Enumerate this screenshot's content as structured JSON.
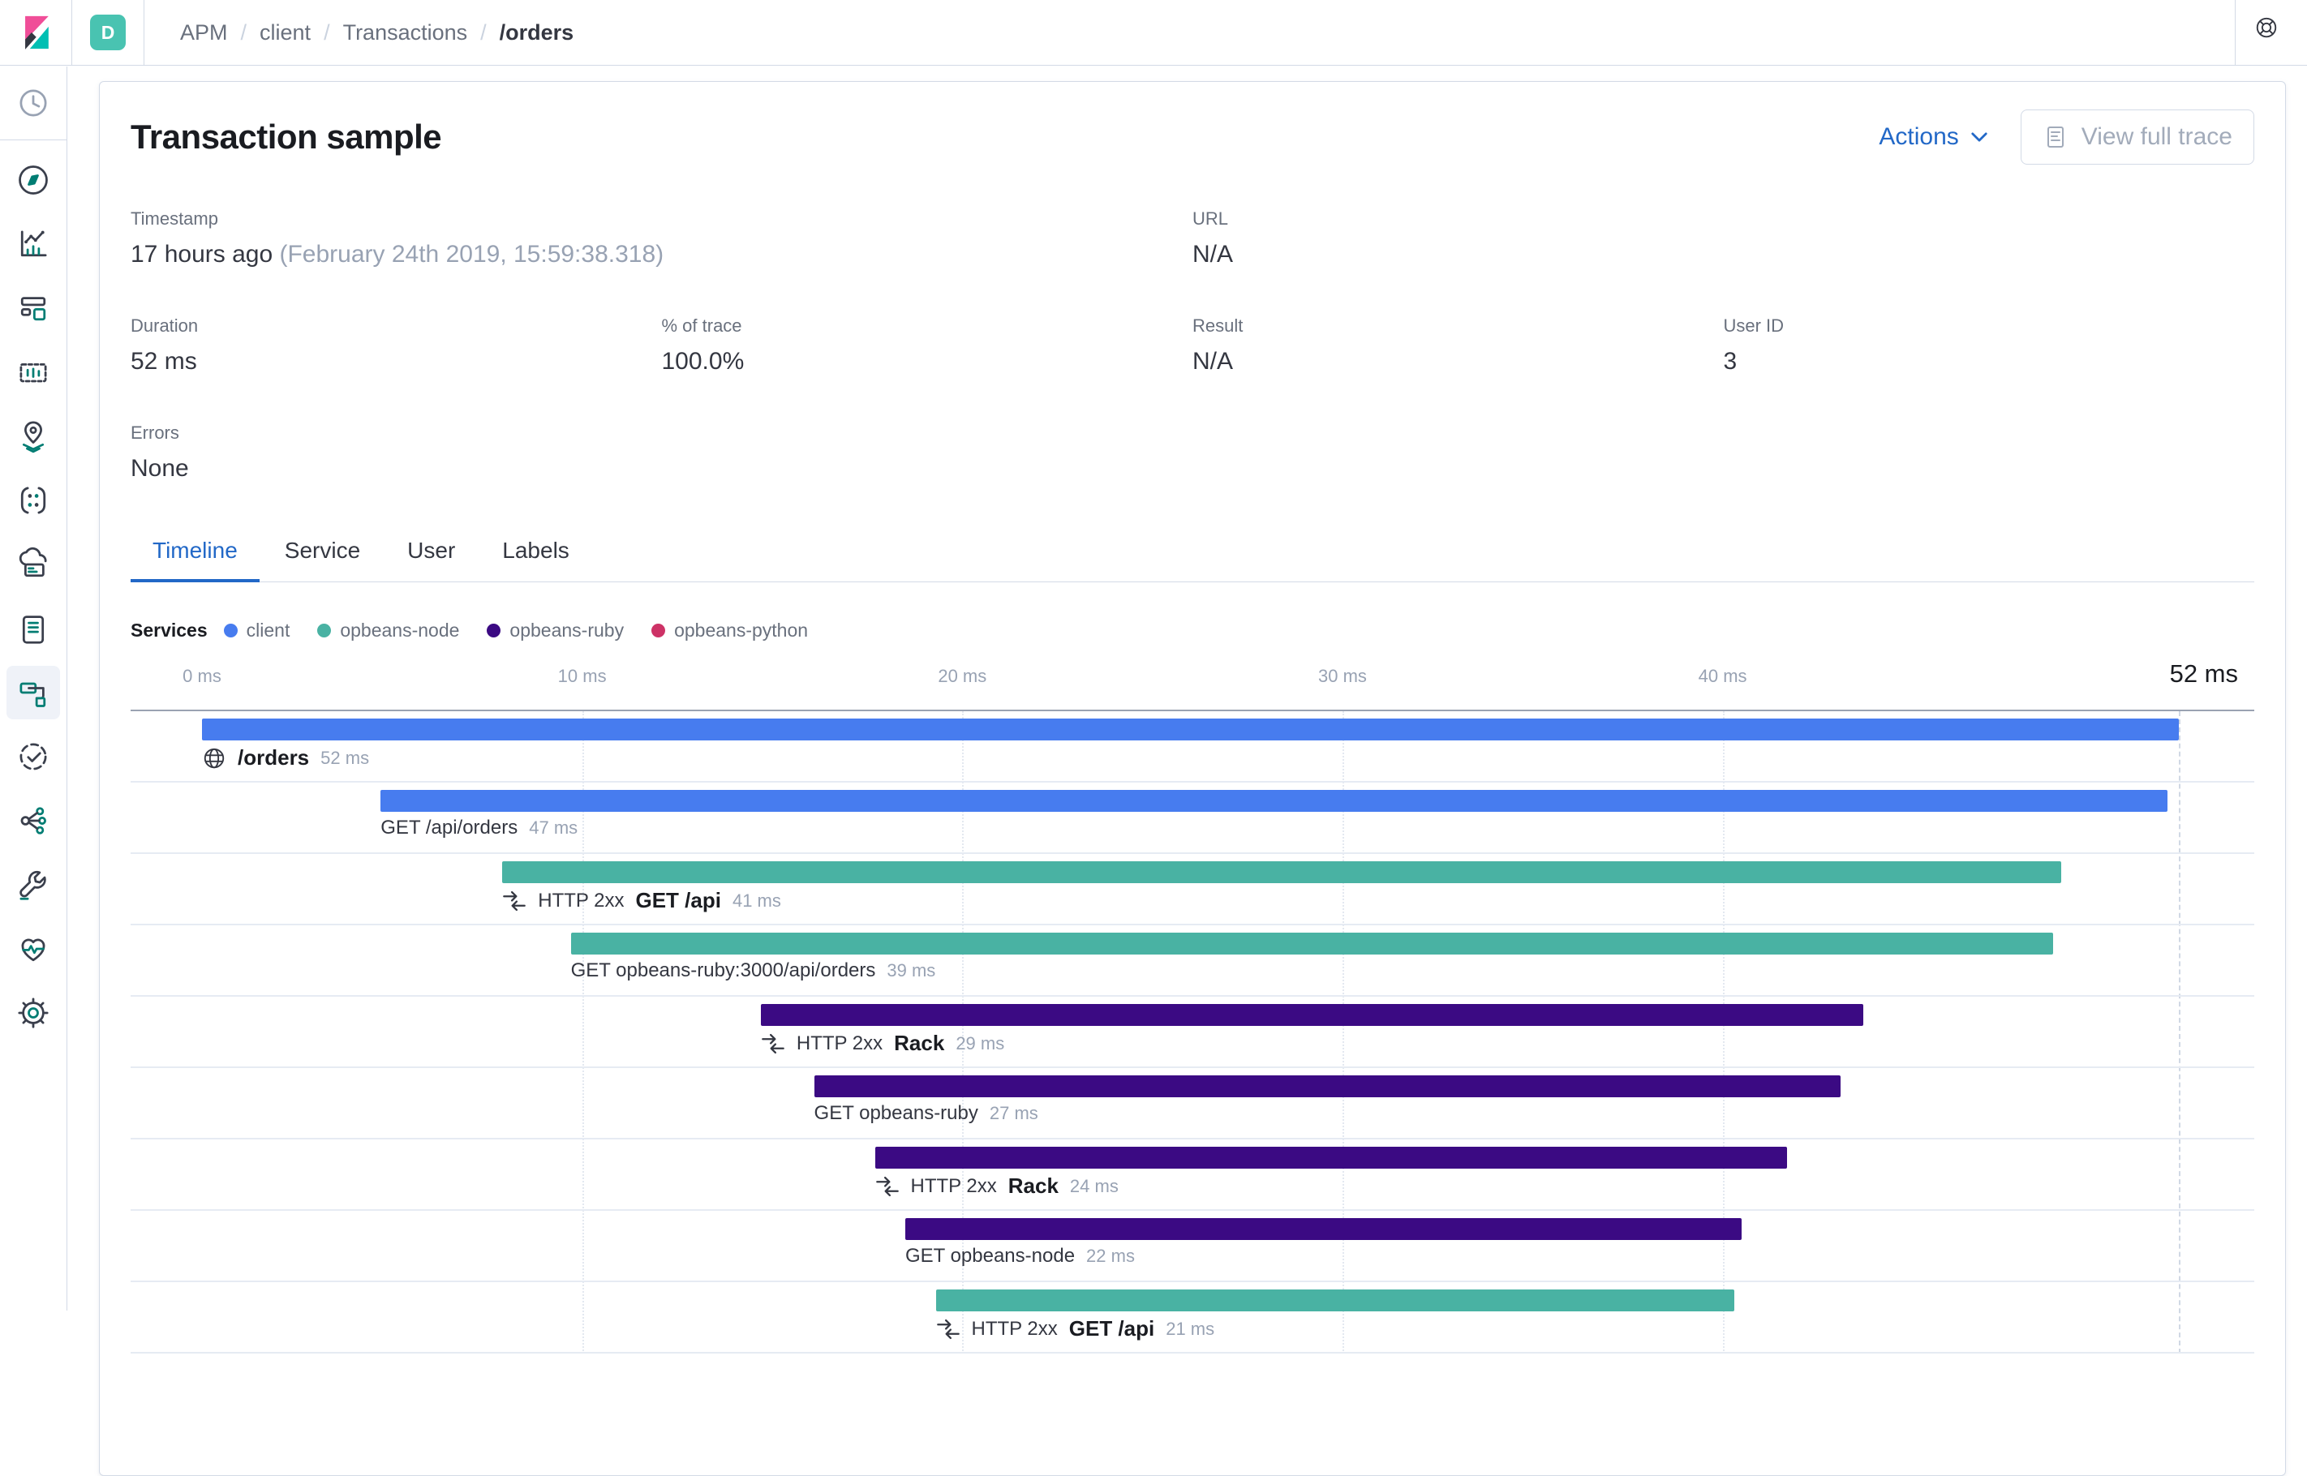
{
  "header": {
    "space_initial": "D",
    "breadcrumb_separator": "/",
    "breadcrumbs": [
      {
        "label": "APM",
        "current": false
      },
      {
        "label": "client",
        "current": false
      },
      {
        "label": "Transactions",
        "current": false
      },
      {
        "label": "/orders",
        "current": true
      }
    ],
    "help_icon": "life-ring-icon"
  },
  "sidebar": {
    "top_item": {
      "icon": "clock-icon",
      "active": false
    },
    "items": [
      {
        "icon": "compass-icon",
        "active": false
      },
      {
        "icon": "bar-chart-icon",
        "active": false
      },
      {
        "icon": "dashboard-icon",
        "active": false
      },
      {
        "icon": "canvas-frame-icon",
        "active": false
      },
      {
        "icon": "map-pin-icon",
        "active": false
      },
      {
        "icon": "ml-nodes-icon",
        "active": false
      },
      {
        "icon": "cloud-server-icon",
        "active": false
      },
      {
        "icon": "scroll-icon",
        "active": false
      },
      {
        "icon": "apm-branch-icon",
        "active": true
      },
      {
        "icon": "clock-check-icon",
        "active": false
      },
      {
        "icon": "share-nodes-icon",
        "active": false
      },
      {
        "icon": "wrench-icon",
        "active": false
      },
      {
        "icon": "heart-pulse-icon",
        "active": false
      },
      {
        "icon": "gear-icon",
        "active": false
      }
    ]
  },
  "page": {
    "title": "Transaction sample",
    "actions_label": "Actions",
    "view_full_trace_label": "View full trace"
  },
  "metadata": {
    "timestamp": {
      "label": "Timestamp",
      "value": "17 hours ago",
      "value_detail": "(February 24th 2019, 15:59:38.318)"
    },
    "url": {
      "label": "URL",
      "value": "N/A"
    },
    "duration": {
      "label": "Duration",
      "value": "52 ms"
    },
    "pct_of_trace": {
      "label": "% of trace",
      "value": "100.0%"
    },
    "result": {
      "label": "Result",
      "value": "N/A"
    },
    "user_id": {
      "label": "User ID",
      "value": "3"
    },
    "errors": {
      "label": "Errors",
      "value": "None"
    }
  },
  "tabs": [
    {
      "label": "Timeline",
      "active": true
    },
    {
      "label": "Service",
      "active": false
    },
    {
      "label": "User",
      "active": false
    },
    {
      "label": "Labels",
      "active": false
    }
  ],
  "legend": {
    "title": "Services",
    "items": [
      {
        "label": "client",
        "color": "#477CEF"
      },
      {
        "label": "opbeans-node",
        "color": "#49B2A3"
      },
      {
        "label": "opbeans-ruby",
        "color": "#3B0A83"
      },
      {
        "label": "opbeans-python",
        "color": "#CD3266"
      }
    ]
  },
  "colors": {
    "accent_blue": "#2268C7",
    "avatar_teal": "#49C3B1",
    "border": "#D3DAE6",
    "muted_text": "#98A2B3"
  },
  "chart_data": {
    "type": "bar",
    "subtype": "waterfall-timeline",
    "unit": "ms",
    "xlim": [
      0,
      52
    ],
    "grid": "vertical-dotted",
    "legend_position": "top",
    "x_ticks": [
      {
        "ms": 0,
        "label": "0 ms"
      },
      {
        "ms": 10,
        "label": "10 ms"
      },
      {
        "ms": 20,
        "label": "20 ms"
      },
      {
        "ms": 30,
        "label": "30 ms"
      },
      {
        "ms": 40,
        "label": "40 ms"
      }
    ],
    "total": {
      "ms": 52,
      "label": "52 ms"
    },
    "services_colors": {
      "client": "#477CEF",
      "opbeans-node": "#49B2A3",
      "opbeans-ruby": "#3B0A83",
      "opbeans-python": "#CD3266"
    },
    "items": [
      {
        "service": "client",
        "icon": "globe-icon",
        "prefix": "",
        "name": "/orders",
        "bold": true,
        "start_ms": 0,
        "duration_ms": 52,
        "duration_label": "52 ms"
      },
      {
        "service": "client",
        "icon": "",
        "prefix": "",
        "name": "GET /api/orders",
        "bold": false,
        "start_ms": 4.7,
        "duration_ms": 47,
        "duration_label": "47 ms"
      },
      {
        "service": "opbeans-node",
        "icon": "merge-icon",
        "prefix": "HTTP 2xx",
        "name": "GET /api",
        "bold": true,
        "start_ms": 7.9,
        "duration_ms": 41,
        "duration_label": "41 ms"
      },
      {
        "service": "opbeans-node",
        "icon": "",
        "prefix": "",
        "name": "GET opbeans-ruby:3000/api/orders",
        "bold": false,
        "start_ms": 9.7,
        "duration_ms": 39,
        "duration_label": "39 ms"
      },
      {
        "service": "opbeans-ruby",
        "icon": "merge-icon",
        "prefix": "HTTP 2xx",
        "name": "Rack",
        "bold": true,
        "start_ms": 14.7,
        "duration_ms": 29,
        "duration_label": "29 ms"
      },
      {
        "service": "opbeans-ruby",
        "icon": "",
        "prefix": "",
        "name": "GET opbeans-ruby",
        "bold": false,
        "start_ms": 16.1,
        "duration_ms": 27,
        "duration_label": "27 ms"
      },
      {
        "service": "opbeans-ruby",
        "icon": "merge-icon",
        "prefix": "HTTP 2xx",
        "name": "Rack",
        "bold": true,
        "start_ms": 17.7,
        "duration_ms": 24,
        "duration_label": "24 ms"
      },
      {
        "service": "opbeans-ruby",
        "icon": "",
        "prefix": "",
        "name": "GET opbeans-node",
        "bold": false,
        "start_ms": 18.5,
        "duration_ms": 22,
        "duration_label": "22 ms"
      },
      {
        "service": "opbeans-node",
        "icon": "merge-icon",
        "prefix": "HTTP 2xx",
        "name": "GET /api",
        "bold": true,
        "start_ms": 19.3,
        "duration_ms": 21,
        "duration_label": "21 ms"
      }
    ]
  }
}
